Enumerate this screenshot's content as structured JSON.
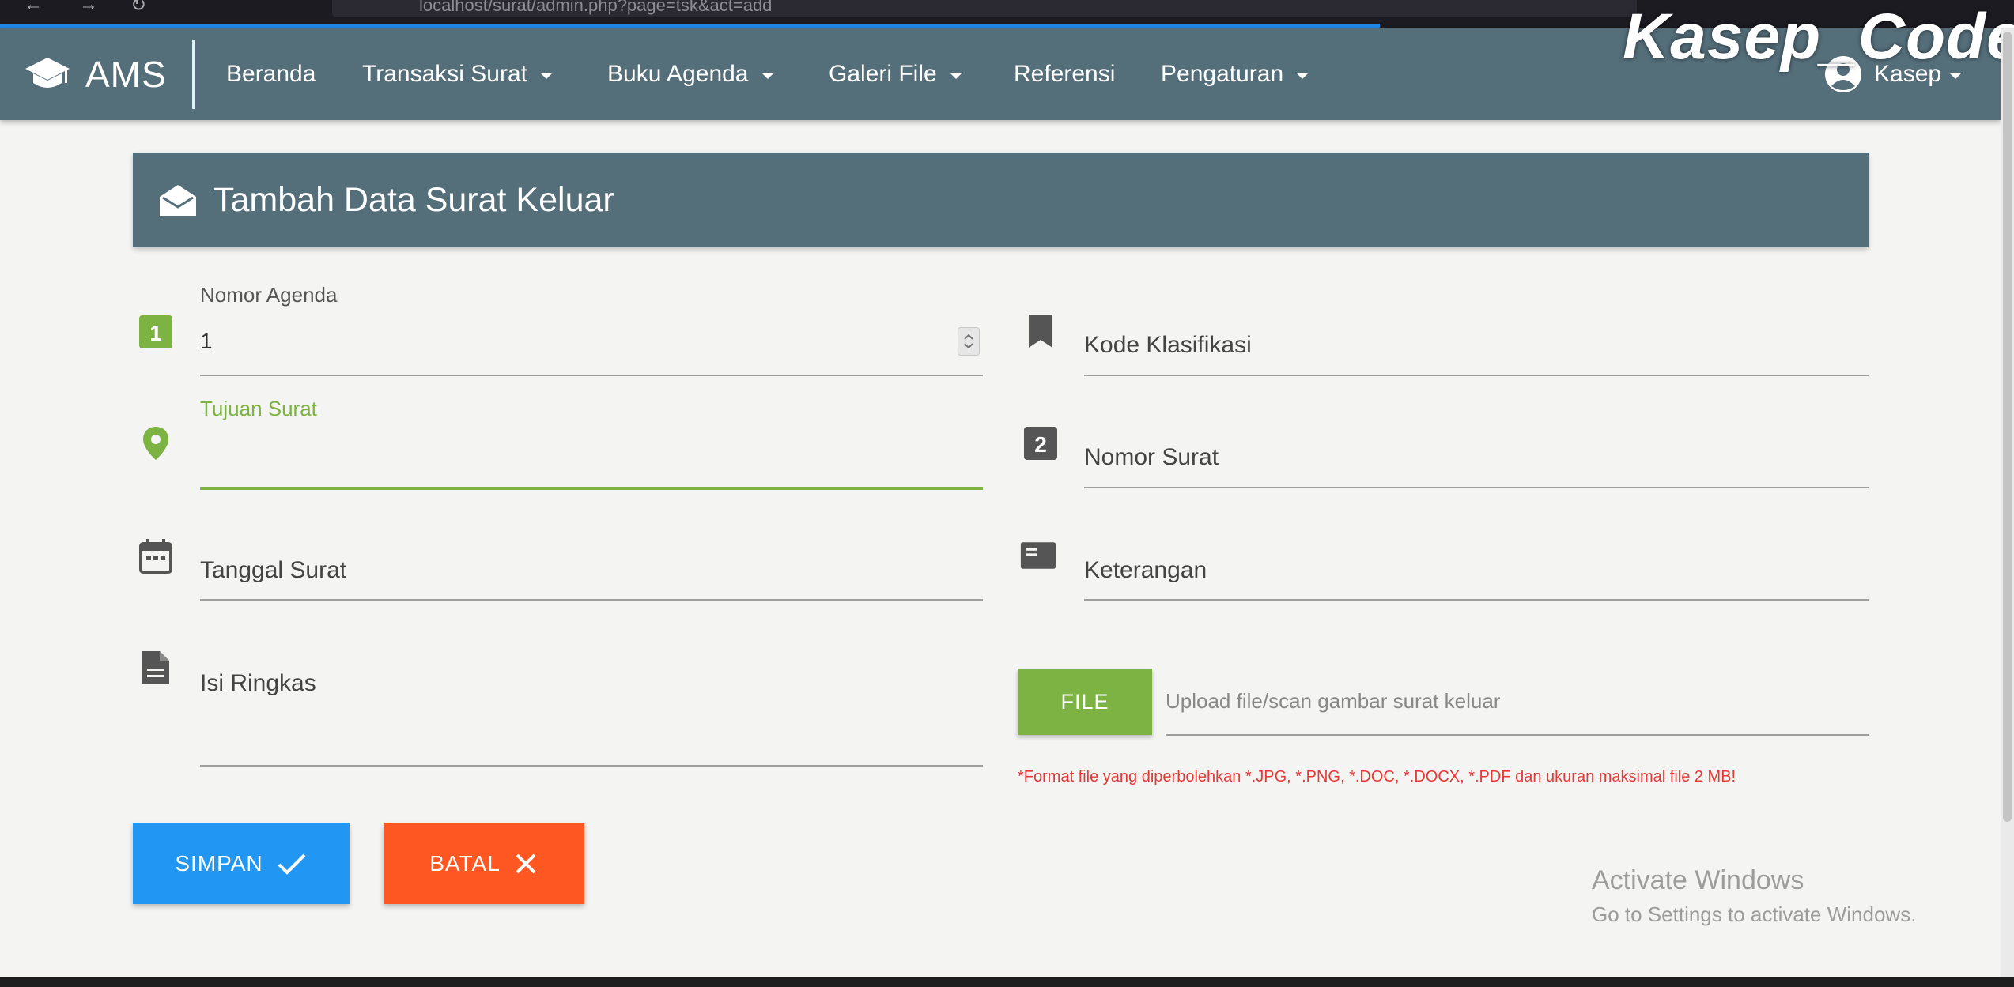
{
  "browser": {
    "url": "localhost/surat/admin.php?page=tsk&act=add"
  },
  "watermark": "Kasep_Code",
  "navbar": {
    "brand": "AMS",
    "items": [
      {
        "label": "Beranda",
        "dropdown": false
      },
      {
        "label": "Transaksi Surat",
        "dropdown": true
      },
      {
        "label": "Buku Agenda",
        "dropdown": true
      },
      {
        "label": "Galeri File",
        "dropdown": true
      },
      {
        "label": "Referensi",
        "dropdown": false
      },
      {
        "label": "Pengaturan",
        "dropdown": true
      }
    ],
    "user": "Kasep"
  },
  "form": {
    "title": "Tambah Data Surat Keluar",
    "nomor_agenda": {
      "label": "Nomor Agenda",
      "value": "1"
    },
    "tujuan_surat": {
      "label": "Tujuan Surat",
      "value": ""
    },
    "tanggal_surat": {
      "label": "Tanggal Surat"
    },
    "isi_ringkas": {
      "label": "Isi Ringkas"
    },
    "kode_klasifikasi": {
      "label": "Kode Klasifikasi"
    },
    "nomor_surat": {
      "label": "Nomor Surat"
    },
    "keterangan": {
      "label": "Keterangan"
    },
    "file": {
      "button_label": "FILE",
      "placeholder": "Upload file/scan gambar surat keluar",
      "note": "*Format file yang diperbolehkan *.JPG, *.PNG, *.DOC, *.DOCX, *.PDF dan ukuran maksimal file 2 MB!"
    },
    "buttons": {
      "save": "SIMPAN",
      "cancel": "BATAL"
    }
  },
  "os_notice": {
    "line1": "Activate Windows",
    "line2": "Go to Settings to activate Windows."
  },
  "colors": {
    "primary": "#546e7a",
    "accent_green": "#7cb342",
    "save_blue": "#2196f3",
    "cancel_orange": "#ff5722",
    "note_red": "#e53935"
  }
}
